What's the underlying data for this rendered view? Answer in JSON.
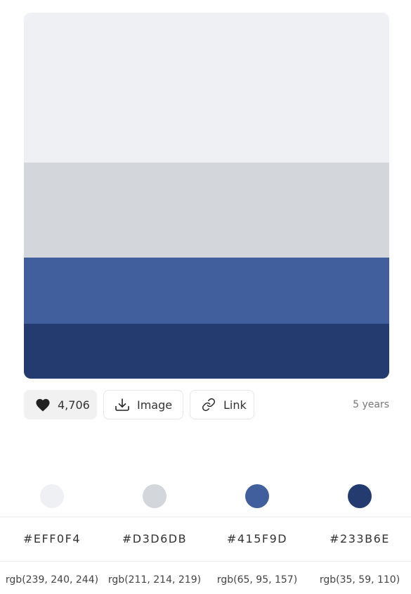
{
  "palette": {
    "colors": [
      {
        "hex": "#EFF0F4",
        "rgb": "rgb(239, 240, 244)"
      },
      {
        "hex": "#D3D6DB",
        "rgb": "rgb(211, 214, 219)"
      },
      {
        "hex": "#415F9D",
        "rgb": "rgb(65, 95, 157)"
      },
      {
        "hex": "#233B6E",
        "rgb": "rgb(35, 59, 110)"
      }
    ]
  },
  "actions": {
    "likes": "4,706",
    "image_label": "Image",
    "link_label": "Link",
    "age": "5 years"
  }
}
